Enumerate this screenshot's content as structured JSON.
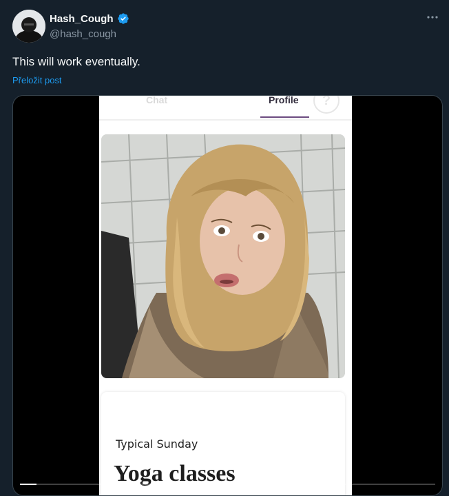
{
  "tweet": {
    "author_name": "Hash_Cough",
    "handle": "@hash_cough",
    "text": "This will work eventually.",
    "translate_label": "Přeložit post",
    "verified_color": "#1d9bf0"
  },
  "icons": {
    "verified": "verified-badge-icon",
    "more": "more-horizontal-icon",
    "help": "question-mark-icon"
  },
  "video": {
    "app_tabs": [
      "Chat",
      "Profile"
    ],
    "active_tab": "Profile",
    "help_glyph": "?",
    "prompt_title": "Typical Sunday",
    "prompt_answer": "Yoga classes",
    "progress": 0.04
  }
}
